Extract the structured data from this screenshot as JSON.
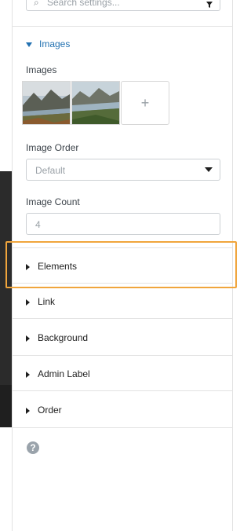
{
  "search": {
    "placeholder": "Search settings..."
  },
  "images_section": {
    "title": "Images",
    "images_label": "Images",
    "add_image_label": "+",
    "image_order_label": "Image Order",
    "image_order_value": "Default",
    "image_count_label": "Image Count",
    "image_count_value": "4"
  },
  "collapsed_sections": [
    "Elements",
    "Link",
    "Background",
    "Admin Label",
    "Order"
  ],
  "help": {
    "label": "?"
  },
  "colors": {
    "accent": "#2271b1",
    "highlight": "#f0a53c"
  }
}
